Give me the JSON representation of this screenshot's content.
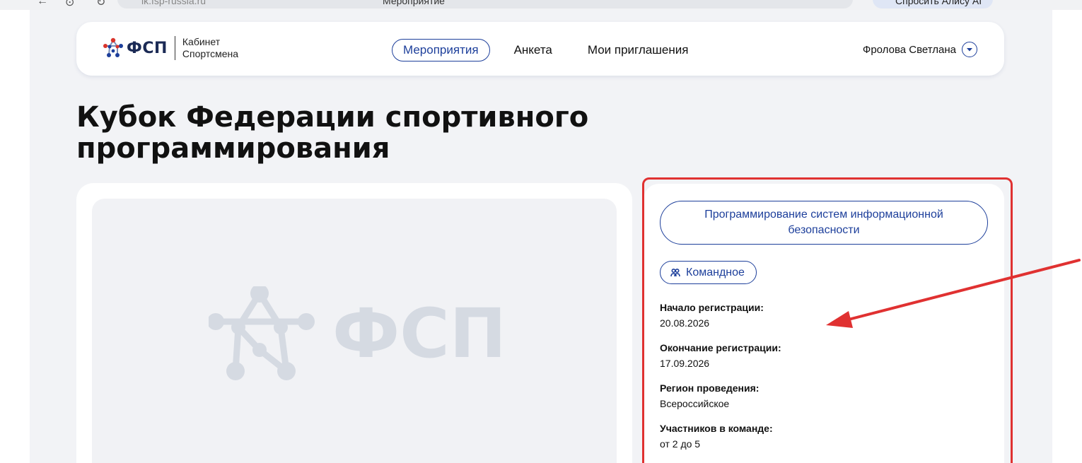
{
  "browser": {
    "url": "lk.fsp-russia.ru",
    "tab_title": "Мероприятие",
    "alice_button": "Спросить Алису AI"
  },
  "header": {
    "logo_text": "ФСП",
    "logo_subtitle_line1": "Кабинет",
    "logo_subtitle_line2": "Спортсмена",
    "nav": [
      {
        "label": "Мероприятия",
        "active": true
      },
      {
        "label": "Анкета",
        "active": false
      },
      {
        "label": "Мои приглашения",
        "active": false
      }
    ],
    "user_name": "Фролова Светлана"
  },
  "event": {
    "title": "Кубок Федерации спортивного программирования",
    "placeholder_logo_text": "ФСП",
    "discipline": "Программирование систем информационной безопасности",
    "format_tag": "Командное",
    "details": [
      {
        "label": "Начало регистрации:",
        "value": "20.08.2026"
      },
      {
        "label": "Окончание регистрации:",
        "value": "17.09.2026"
      },
      {
        "label": "Регион проведения:",
        "value": "Всероссийское"
      },
      {
        "label": "Участников в команде:",
        "value": "от 2 до 5"
      }
    ]
  },
  "colors": {
    "accent": "#1d3f9b",
    "page_bg": "#f2f3f6",
    "annotation": "#e03131",
    "logo_red": "#d9342b",
    "logo_blue": "#1d3f9b",
    "placeholder_gray": "#d5dae2"
  },
  "icons": [
    "user-chevron-icon",
    "team-icon",
    "fsp-logo-icon"
  ]
}
